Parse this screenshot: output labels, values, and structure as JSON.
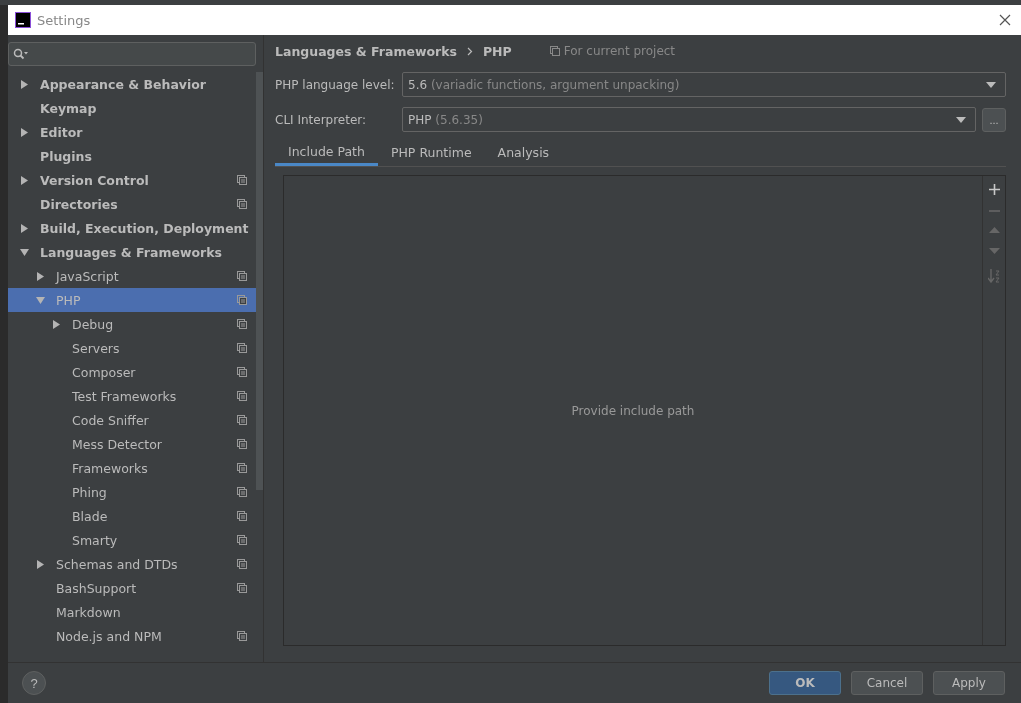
{
  "window": {
    "title": "Settings"
  },
  "tree": [
    {
      "label": "Appearance & Behavior",
      "expanded": false,
      "project_scope": false,
      "selected": false
    },
    {
      "label": "Keymap",
      "project_scope": false,
      "selected": false
    },
    {
      "label": "Editor",
      "expanded": false,
      "project_scope": false,
      "selected": false
    },
    {
      "label": "Plugins",
      "project_scope": false,
      "selected": false
    },
    {
      "label": "Version Control",
      "expanded": false,
      "project_scope": true,
      "selected": false
    },
    {
      "label": "Directories",
      "project_scope": true,
      "selected": false
    },
    {
      "label": "Build, Execution, Deployment",
      "expanded": false,
      "project_scope": false,
      "selected": false
    },
    {
      "label": "Languages & Frameworks",
      "expanded": true,
      "project_scope": false,
      "selected": false,
      "children": [
        {
          "label": "JavaScript",
          "expanded": false,
          "project_scope": true,
          "selected": false
        },
        {
          "label": "PHP",
          "expanded": true,
          "project_scope": true,
          "selected": true,
          "children": [
            {
              "label": "Debug",
              "expanded": false,
              "project_scope": true,
              "selected": false
            },
            {
              "label": "Servers",
              "project_scope": true,
              "selected": false
            },
            {
              "label": "Composer",
              "project_scope": true,
              "selected": false
            },
            {
              "label": "Test Frameworks",
              "project_scope": true,
              "selected": false
            },
            {
              "label": "Code Sniffer",
              "project_scope": true,
              "selected": false
            },
            {
              "label": "Mess Detector",
              "project_scope": true,
              "selected": false
            },
            {
              "label": "Frameworks",
              "project_scope": true,
              "selected": false
            },
            {
              "label": "Phing",
              "project_scope": true,
              "selected": false
            },
            {
              "label": "Blade",
              "project_scope": true,
              "selected": false
            },
            {
              "label": "Smarty",
              "project_scope": true,
              "selected": false
            }
          ]
        },
        {
          "label": "Schemas and DTDs",
          "expanded": false,
          "project_scope": true,
          "selected": false
        },
        {
          "label": "BashSupport",
          "project_scope": true,
          "selected": false
        },
        {
          "label": "Markdown",
          "project_scope": false,
          "selected": false
        },
        {
          "label": "Node.js and NPM",
          "project_scope": true,
          "selected": false
        }
      ]
    }
  ],
  "breadcrumb": [
    "Languages & Frameworks",
    "PHP"
  ],
  "scope_note": "For current project",
  "fields": [
    {
      "label": "PHP language level:",
      "value": "5.6",
      "detail": "(variadic functions, argument unpacking)",
      "more_button": false
    },
    {
      "label": "CLI Interpreter:",
      "value": "PHP",
      "detail": "(5.6.35)",
      "more_button": true,
      "more_label": "..."
    }
  ],
  "tabs": [
    {
      "label": "Include Path",
      "selected": true
    },
    {
      "label": "PHP Runtime",
      "selected": false
    },
    {
      "label": "Analysis",
      "selected": false
    }
  ],
  "include_path": {
    "empty_text": "Provide include path"
  },
  "help": "?",
  "buttons": [
    {
      "label": "OK",
      "kind": "primary"
    },
    {
      "label": "Cancel",
      "kind": "normal"
    },
    {
      "label": "Apply",
      "kind": "normal"
    }
  ]
}
